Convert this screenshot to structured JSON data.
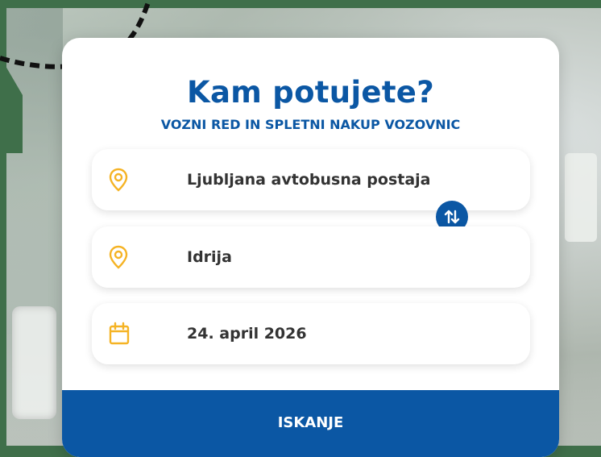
{
  "heading": {
    "title": "Kam potujete?",
    "subtitle": "VOZNI RED IN SPLETNI NAKUP VOZOVNIC"
  },
  "form": {
    "from": {
      "value": "Ljubljana avtobusna postaja",
      "icon": "location-pin-icon"
    },
    "to": {
      "value": "Idrija",
      "icon": "location-pin-icon"
    },
    "date": {
      "value": "24. april 2026",
      "icon": "calendar-icon"
    },
    "swap_icon": "swap-arrows-icon",
    "search_label": "ISKANJE"
  },
  "colors": {
    "brand_blue": "#0b57a4",
    "icon_yellow": "#f5b324",
    "frame_green": "#3f6f4a"
  }
}
